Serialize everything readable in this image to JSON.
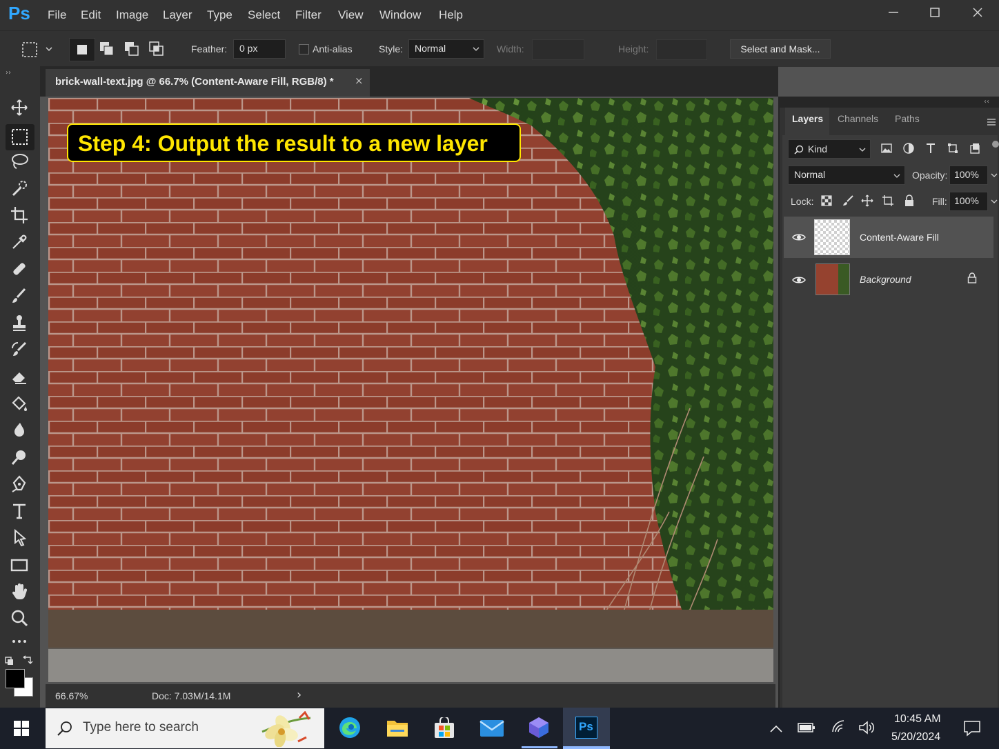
{
  "app": {
    "logo": "Ps"
  },
  "menu": [
    "File",
    "Edit",
    "Image",
    "Layer",
    "Type",
    "Select",
    "Filter",
    "View",
    "Window",
    "Help"
  ],
  "options": {
    "feather_label": "Feather:",
    "feather_value": "0 px",
    "antialias_label": "Anti-alias",
    "style_label": "Style:",
    "style_value": "Normal",
    "width_label": "Width:",
    "height_label": "Height:",
    "select_mask": "Select and Mask..."
  },
  "document": {
    "tab_title": "brick-wall-text.jpg @ 66.7% (Content-Aware Fill, RGB/8) *",
    "close": "×",
    "banner": "Step 4: Output the result to a new layer"
  },
  "status": {
    "zoom": "66.67%",
    "doc": "Doc: 7.03M/14.1M",
    "arrow": "›"
  },
  "panel": {
    "tabs": [
      "Layers",
      "Channels",
      "Paths"
    ],
    "kind": "Kind",
    "blend": "Normal",
    "opacity_label": "Opacity:",
    "opacity": "100%",
    "lock_label": "Lock:",
    "fill_label": "Fill:",
    "fill": "100%",
    "layers": [
      {
        "name": "Content-Aware Fill"
      },
      {
        "name": "Background"
      }
    ]
  },
  "taskbar": {
    "search_placeholder": "Type here to search",
    "time": "10:45 AM",
    "date": "5/20/2024"
  },
  "colors": {
    "accent": "#31a8ff",
    "banner_bg": "#000000",
    "banner_text": "#ffe600",
    "brick": "#8a3a28"
  }
}
